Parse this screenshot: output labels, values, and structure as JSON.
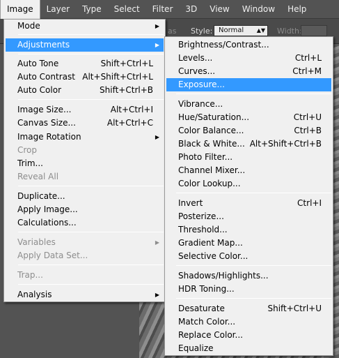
{
  "menubar": {
    "items": [
      {
        "label": "Image",
        "active": true
      },
      {
        "label": "Layer",
        "active": false
      },
      {
        "label": "Type",
        "active": false
      },
      {
        "label": "Select",
        "active": false
      },
      {
        "label": "Filter",
        "active": false
      },
      {
        "label": "3D",
        "active": false
      },
      {
        "label": "View",
        "active": false
      },
      {
        "label": "Window",
        "active": false
      },
      {
        "label": "Help",
        "active": false
      }
    ]
  },
  "options_bar": {
    "partial_label": "as",
    "style_label": "Style:",
    "style_value": "Normal",
    "width_label": "Width:"
  },
  "image_menu": {
    "items": [
      {
        "label": "Mode",
        "shortcut": "",
        "submenu": true
      },
      {
        "label": "Adjustments",
        "shortcut": "",
        "submenu": true,
        "highlighted": true
      },
      {
        "label": "Auto Tone",
        "shortcut": "Shift+Ctrl+L"
      },
      {
        "label": "Auto Contrast",
        "shortcut": "Alt+Shift+Ctrl+L"
      },
      {
        "label": "Auto Color",
        "shortcut": "Shift+Ctrl+B"
      },
      {
        "label": "Image Size...",
        "shortcut": "Alt+Ctrl+I"
      },
      {
        "label": "Canvas Size...",
        "shortcut": "Alt+Ctrl+C"
      },
      {
        "label": "Image Rotation",
        "shortcut": "",
        "submenu": true
      },
      {
        "label": "Crop",
        "shortcut": "",
        "disabled": true
      },
      {
        "label": "Trim...",
        "shortcut": ""
      },
      {
        "label": "Reveal All",
        "shortcut": "",
        "disabled": true
      },
      {
        "label": "Duplicate...",
        "shortcut": ""
      },
      {
        "label": "Apply Image...",
        "shortcut": ""
      },
      {
        "label": "Calculations...",
        "shortcut": ""
      },
      {
        "label": "Variables",
        "shortcut": "",
        "submenu": true,
        "disabled": true
      },
      {
        "label": "Apply Data Set...",
        "shortcut": "",
        "disabled": true
      },
      {
        "label": "Trap...",
        "shortcut": "",
        "disabled": true
      },
      {
        "label": "Analysis",
        "shortcut": "",
        "submenu": true
      }
    ]
  },
  "adjustments_menu": {
    "items": [
      {
        "label": "Brightness/Contrast...",
        "shortcut": ""
      },
      {
        "label": "Levels...",
        "shortcut": "Ctrl+L"
      },
      {
        "label": "Curves...",
        "shortcut": "Ctrl+M"
      },
      {
        "label": "Exposure...",
        "shortcut": "",
        "highlighted": true
      },
      {
        "label": "Vibrance...",
        "shortcut": ""
      },
      {
        "label": "Hue/Saturation...",
        "shortcut": "Ctrl+U"
      },
      {
        "label": "Color Balance...",
        "shortcut": "Ctrl+B"
      },
      {
        "label": "Black & White...",
        "shortcut": "Alt+Shift+Ctrl+B"
      },
      {
        "label": "Photo Filter...",
        "shortcut": ""
      },
      {
        "label": "Channel Mixer...",
        "shortcut": ""
      },
      {
        "label": "Color Lookup...",
        "shortcut": ""
      },
      {
        "label": "Invert",
        "shortcut": "Ctrl+I"
      },
      {
        "label": "Posterize...",
        "shortcut": ""
      },
      {
        "label": "Threshold...",
        "shortcut": ""
      },
      {
        "label": "Gradient Map...",
        "shortcut": ""
      },
      {
        "label": "Selective Color...",
        "shortcut": ""
      },
      {
        "label": "Shadows/Highlights...",
        "shortcut": ""
      },
      {
        "label": "HDR Toning...",
        "shortcut": ""
      },
      {
        "label": "Desaturate",
        "shortcut": "Shift+Ctrl+U"
      },
      {
        "label": "Match Color...",
        "shortcut": ""
      },
      {
        "label": "Replace Color...",
        "shortcut": ""
      },
      {
        "label": "Equalize",
        "shortcut": ""
      }
    ]
  },
  "colors": {
    "highlight": "#3399ff",
    "menu_bg": "#f0f0f0",
    "chrome_bg": "#535353",
    "disabled_text": "#8d8d8d"
  },
  "icons": {
    "submenu": "triangle-right-icon",
    "dropdown": "double-arrow-icon"
  }
}
